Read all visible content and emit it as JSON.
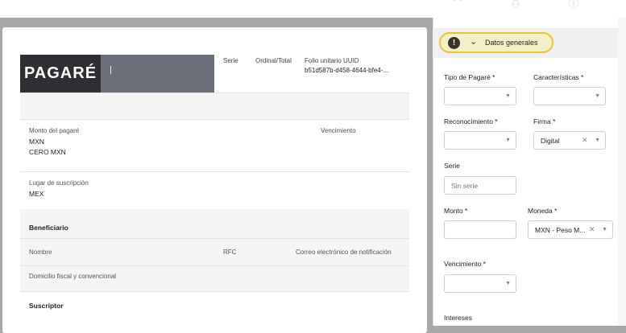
{
  "top_icons": [
    "paperclip-icon",
    "users-icon",
    "info-icon"
  ],
  "document": {
    "title": "PAGARÉ",
    "header": {
      "serie_label": "Serie",
      "ordinal_label": "Ordinal/Total",
      "folio_label": "Folio unitario UUID",
      "folio_value": "b51d587b-d458-4644-bfe4-..."
    },
    "monto_label": "Monto del pagaré",
    "monto_currency": "MXN",
    "monto_text": "CERO MXN",
    "vencimiento_label": "Vencimiento",
    "lugar_label": "Lugar de suscripción",
    "lugar_value": "MEX",
    "beneficiario_title": "Beneficiario",
    "nombre_label": "Nombre",
    "rfc_label": "RFC",
    "correo_label": "Correo electrónico de notificación",
    "domicilio_label": "Domicilio fiscal y convencional",
    "suscriptor_title": "Suscriptor"
  },
  "form": {
    "section_title": "Datos generales",
    "tipo_label": "Tipo de Pagaré *",
    "caracteristicas_label": "Características *",
    "reconocimiento_label": "Reconocimiento *",
    "firma_label": "Firma *",
    "firma_value": "Digital",
    "serie_label": "Serie",
    "serie_placeholder": "Sin serie",
    "monto_label": "Monto *",
    "moneda_label": "Moneda *",
    "moneda_value": "MXN - Peso M...",
    "vencimiento_label": "Vencimiento *",
    "intereses_label": "Intereses"
  },
  "colors": {
    "title_dark": "#2f2f33",
    "title_grey": "#6b6f79",
    "highlight_border": "#e8c43a",
    "highlight_fill": "#f4efc4"
  }
}
